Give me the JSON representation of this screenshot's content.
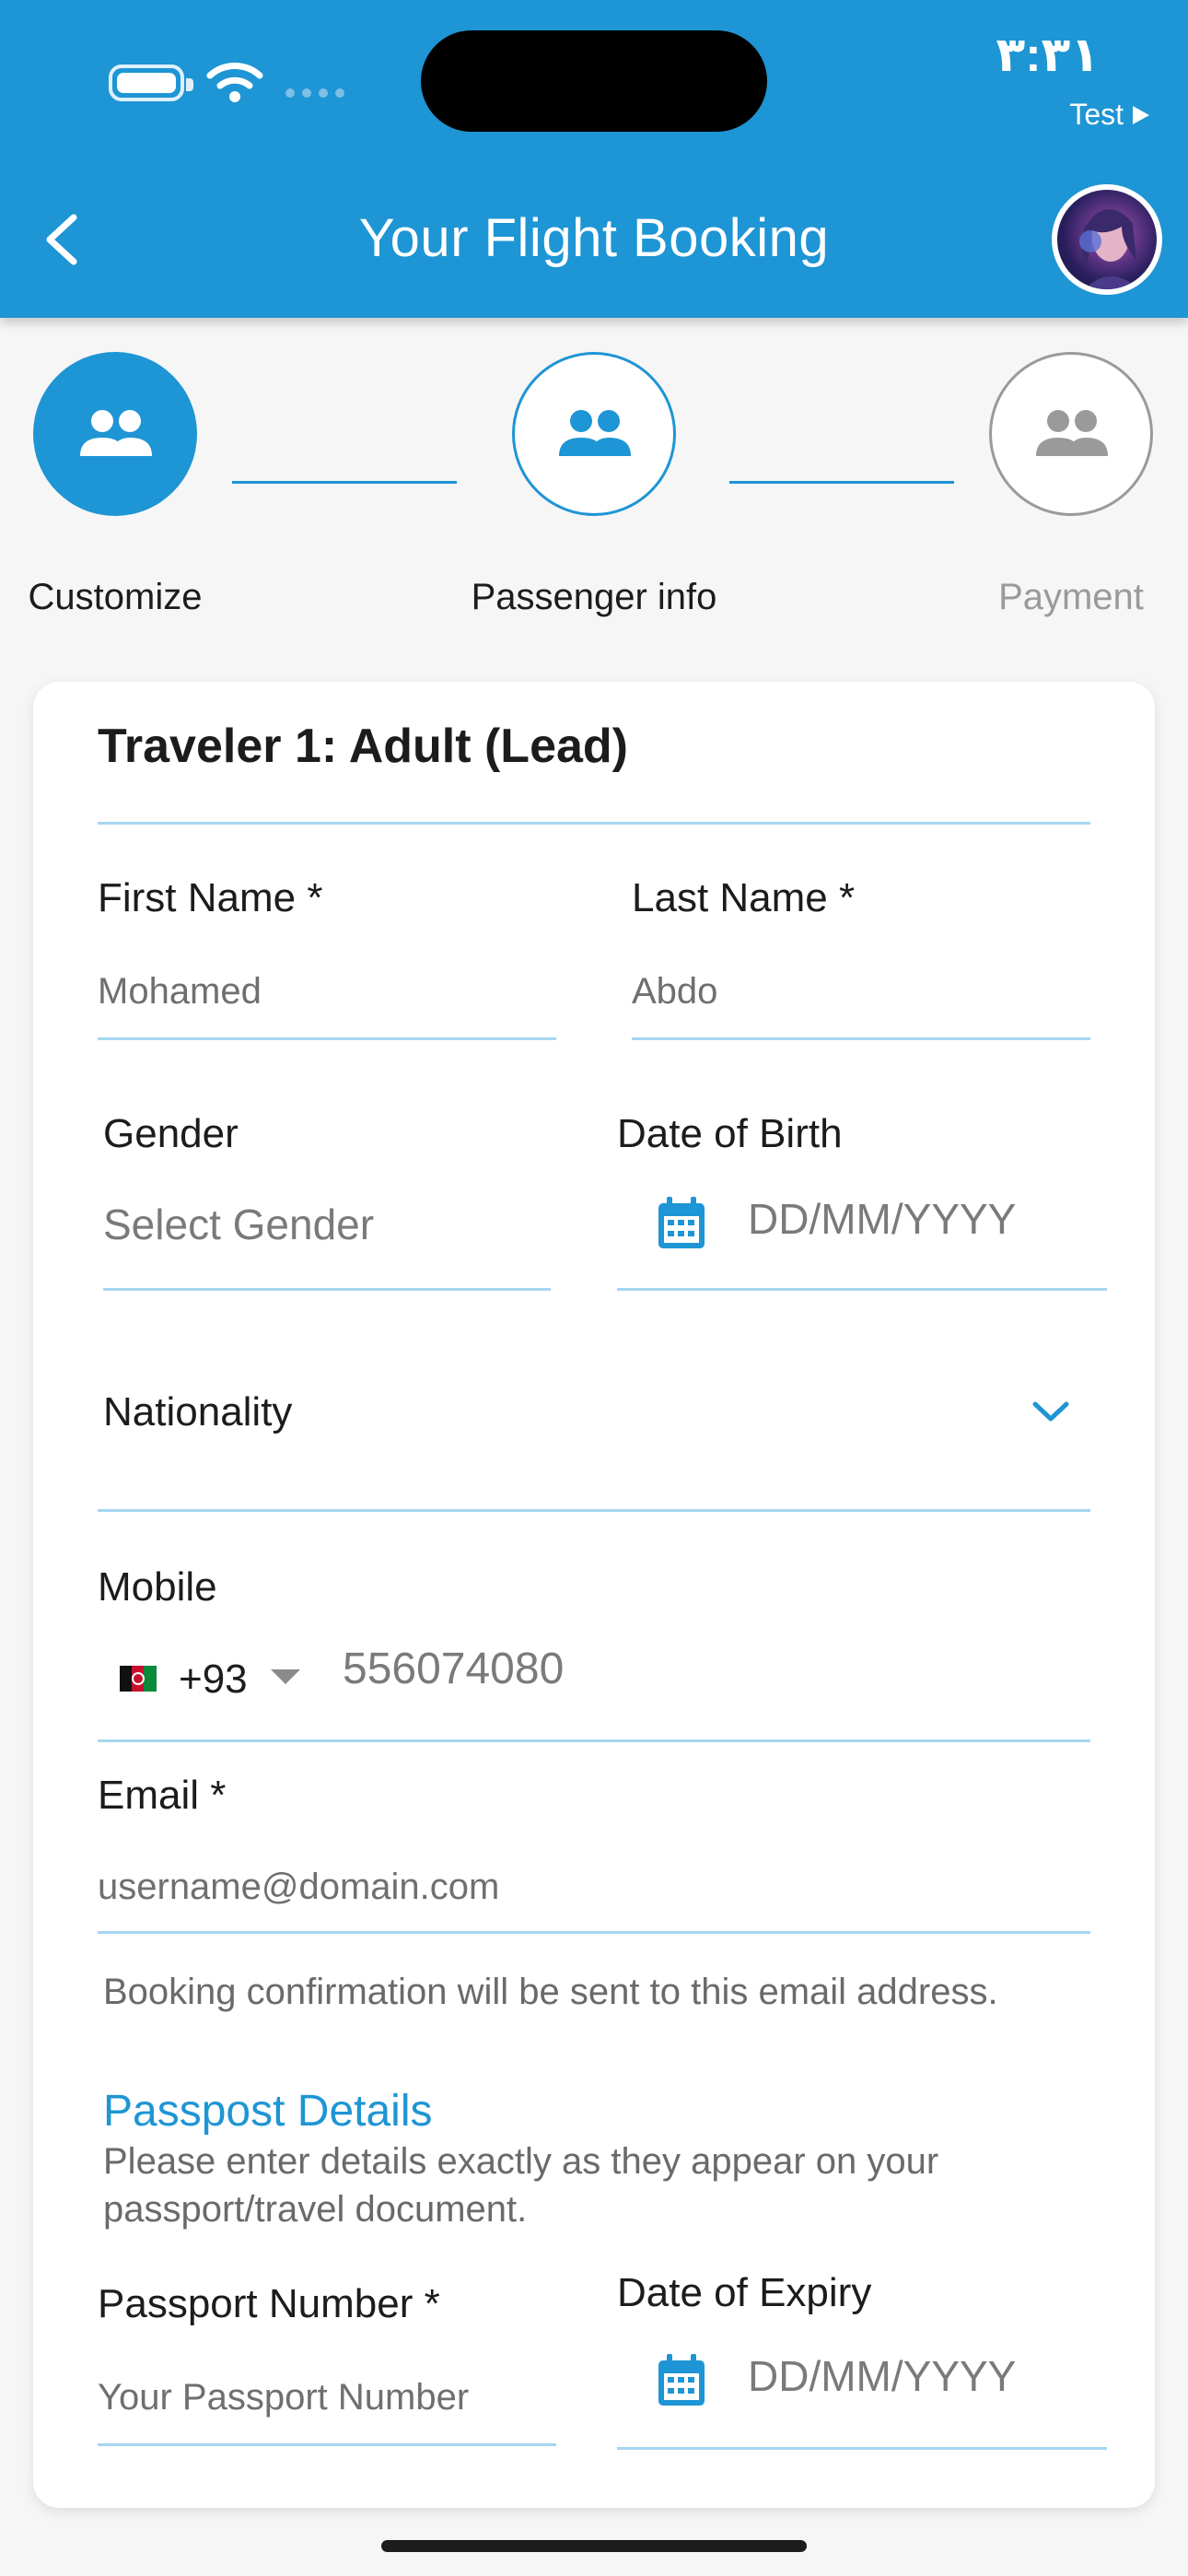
{
  "status_bar": {
    "time": "٣:٣١",
    "carrier": "Test"
  },
  "header": {
    "title": "Your Flight Booking"
  },
  "stepper": {
    "steps": [
      {
        "label": "Customize",
        "state": "completed"
      },
      {
        "label": "Passenger info",
        "state": "current"
      },
      {
        "label": "Payment",
        "state": "upcoming"
      }
    ]
  },
  "form": {
    "traveler_title": "Traveler 1: Adult (Lead)",
    "first_name": {
      "label": "First Name *",
      "placeholder": "Mohamed"
    },
    "last_name": {
      "label": "Last Name *",
      "placeholder": "Abdo"
    },
    "gender": {
      "label": "Gender",
      "placeholder": "Select Gender"
    },
    "dob": {
      "label": "Date of Birth",
      "placeholder": "DD/MM/YYYY"
    },
    "nationality": {
      "label": "Nationality"
    },
    "mobile": {
      "label": "Mobile",
      "country_code": "+93",
      "placeholder": "556074080"
    },
    "email": {
      "label": "Email *",
      "placeholder": "username@domain.com",
      "helper": "Booking confirmation will be sent to this email address."
    },
    "passport": {
      "section_title": "Passpost Details",
      "section_desc": "Please enter details exactly as they appear on your passport/travel document.",
      "number_label": "Passport Number *",
      "number_placeholder": "Your Passport Number",
      "expiry_label": "Date of Expiry",
      "expiry_placeholder": "DD/MM/YYYY"
    }
  },
  "colors": {
    "primary": "#1e95d4",
    "divider": "#a6d6f0",
    "inactive": "#9a9a9a",
    "background": "#f6f6f6"
  }
}
